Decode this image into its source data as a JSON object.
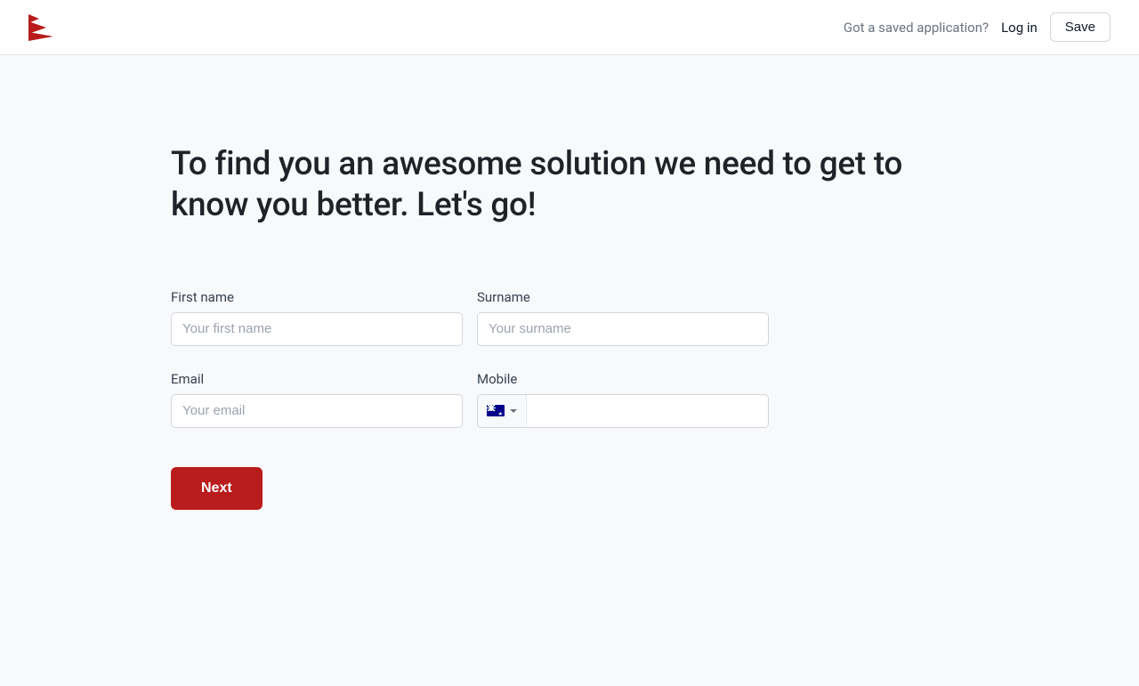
{
  "header": {
    "saved_prompt": "Got a saved application?",
    "login_label": "Log in",
    "save_label": "Save"
  },
  "page": {
    "heading": "To find you an awesome solution we need to get to know you better. Let's go!"
  },
  "form": {
    "first_name": {
      "label": "First name",
      "placeholder": "Your first name",
      "value": ""
    },
    "surname": {
      "label": "Surname",
      "placeholder": "Your surname",
      "value": ""
    },
    "email": {
      "label": "Email",
      "placeholder": "Your email",
      "value": ""
    },
    "mobile": {
      "label": "Mobile",
      "value": "",
      "country": "AU"
    },
    "next_label": "Next"
  }
}
